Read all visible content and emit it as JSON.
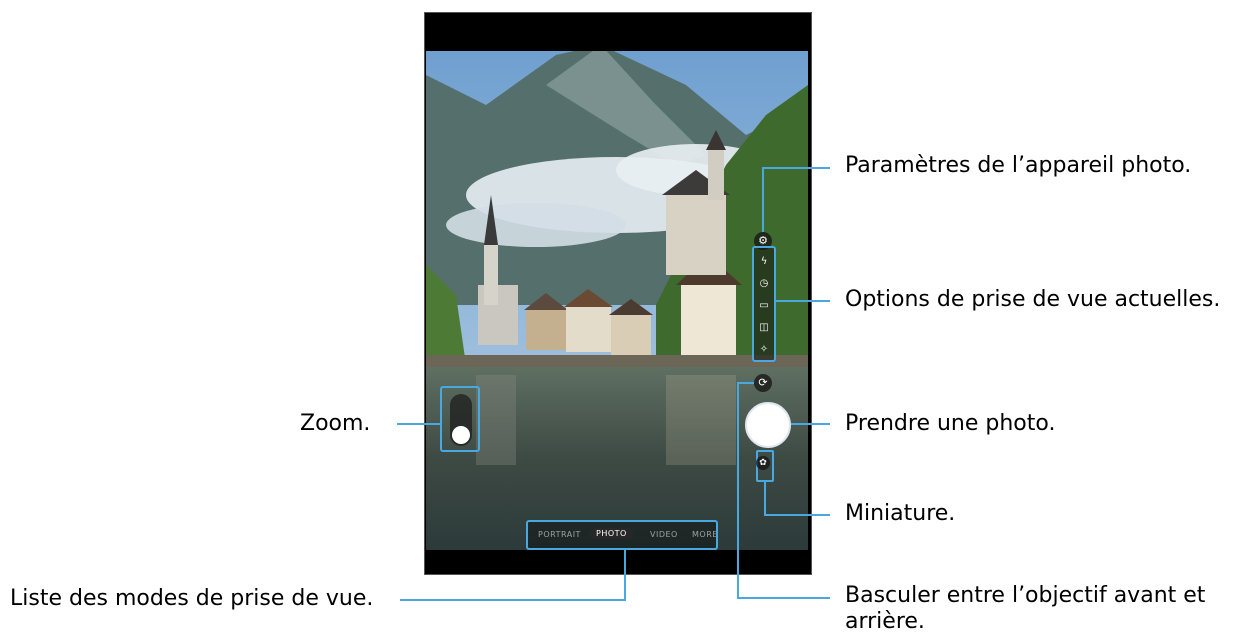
{
  "callouts": {
    "settings": "Paramètres de l’appareil photo.",
    "options": "Options de prise de vue actuelles.",
    "capture": "Prendre une photo.",
    "thumbnail": "Miniature.",
    "switch_line1": "Basculer entre l’objectif avant et",
    "switch_line2": "arrière.",
    "zoom": "Zoom.",
    "modes": "Liste des modes de prise de vue."
  },
  "camera": {
    "modes": [
      "PORTRAIT",
      "PHOTO",
      "VIDEO",
      "MORE"
    ],
    "active_mode": "PHOTO",
    "option_icons": [
      "flash-icon",
      "timer-icon",
      "ratio-icon",
      "motion-photo-icon",
      "filter-icon"
    ],
    "settings_icon": "gear-icon",
    "switch_icon": "rotate-camera-icon",
    "thumbnail_icon": "thumbnail-icon"
  },
  "colors": {
    "callout_line": "#4aa8e0",
    "highlight_box": "#4aa8e0"
  }
}
